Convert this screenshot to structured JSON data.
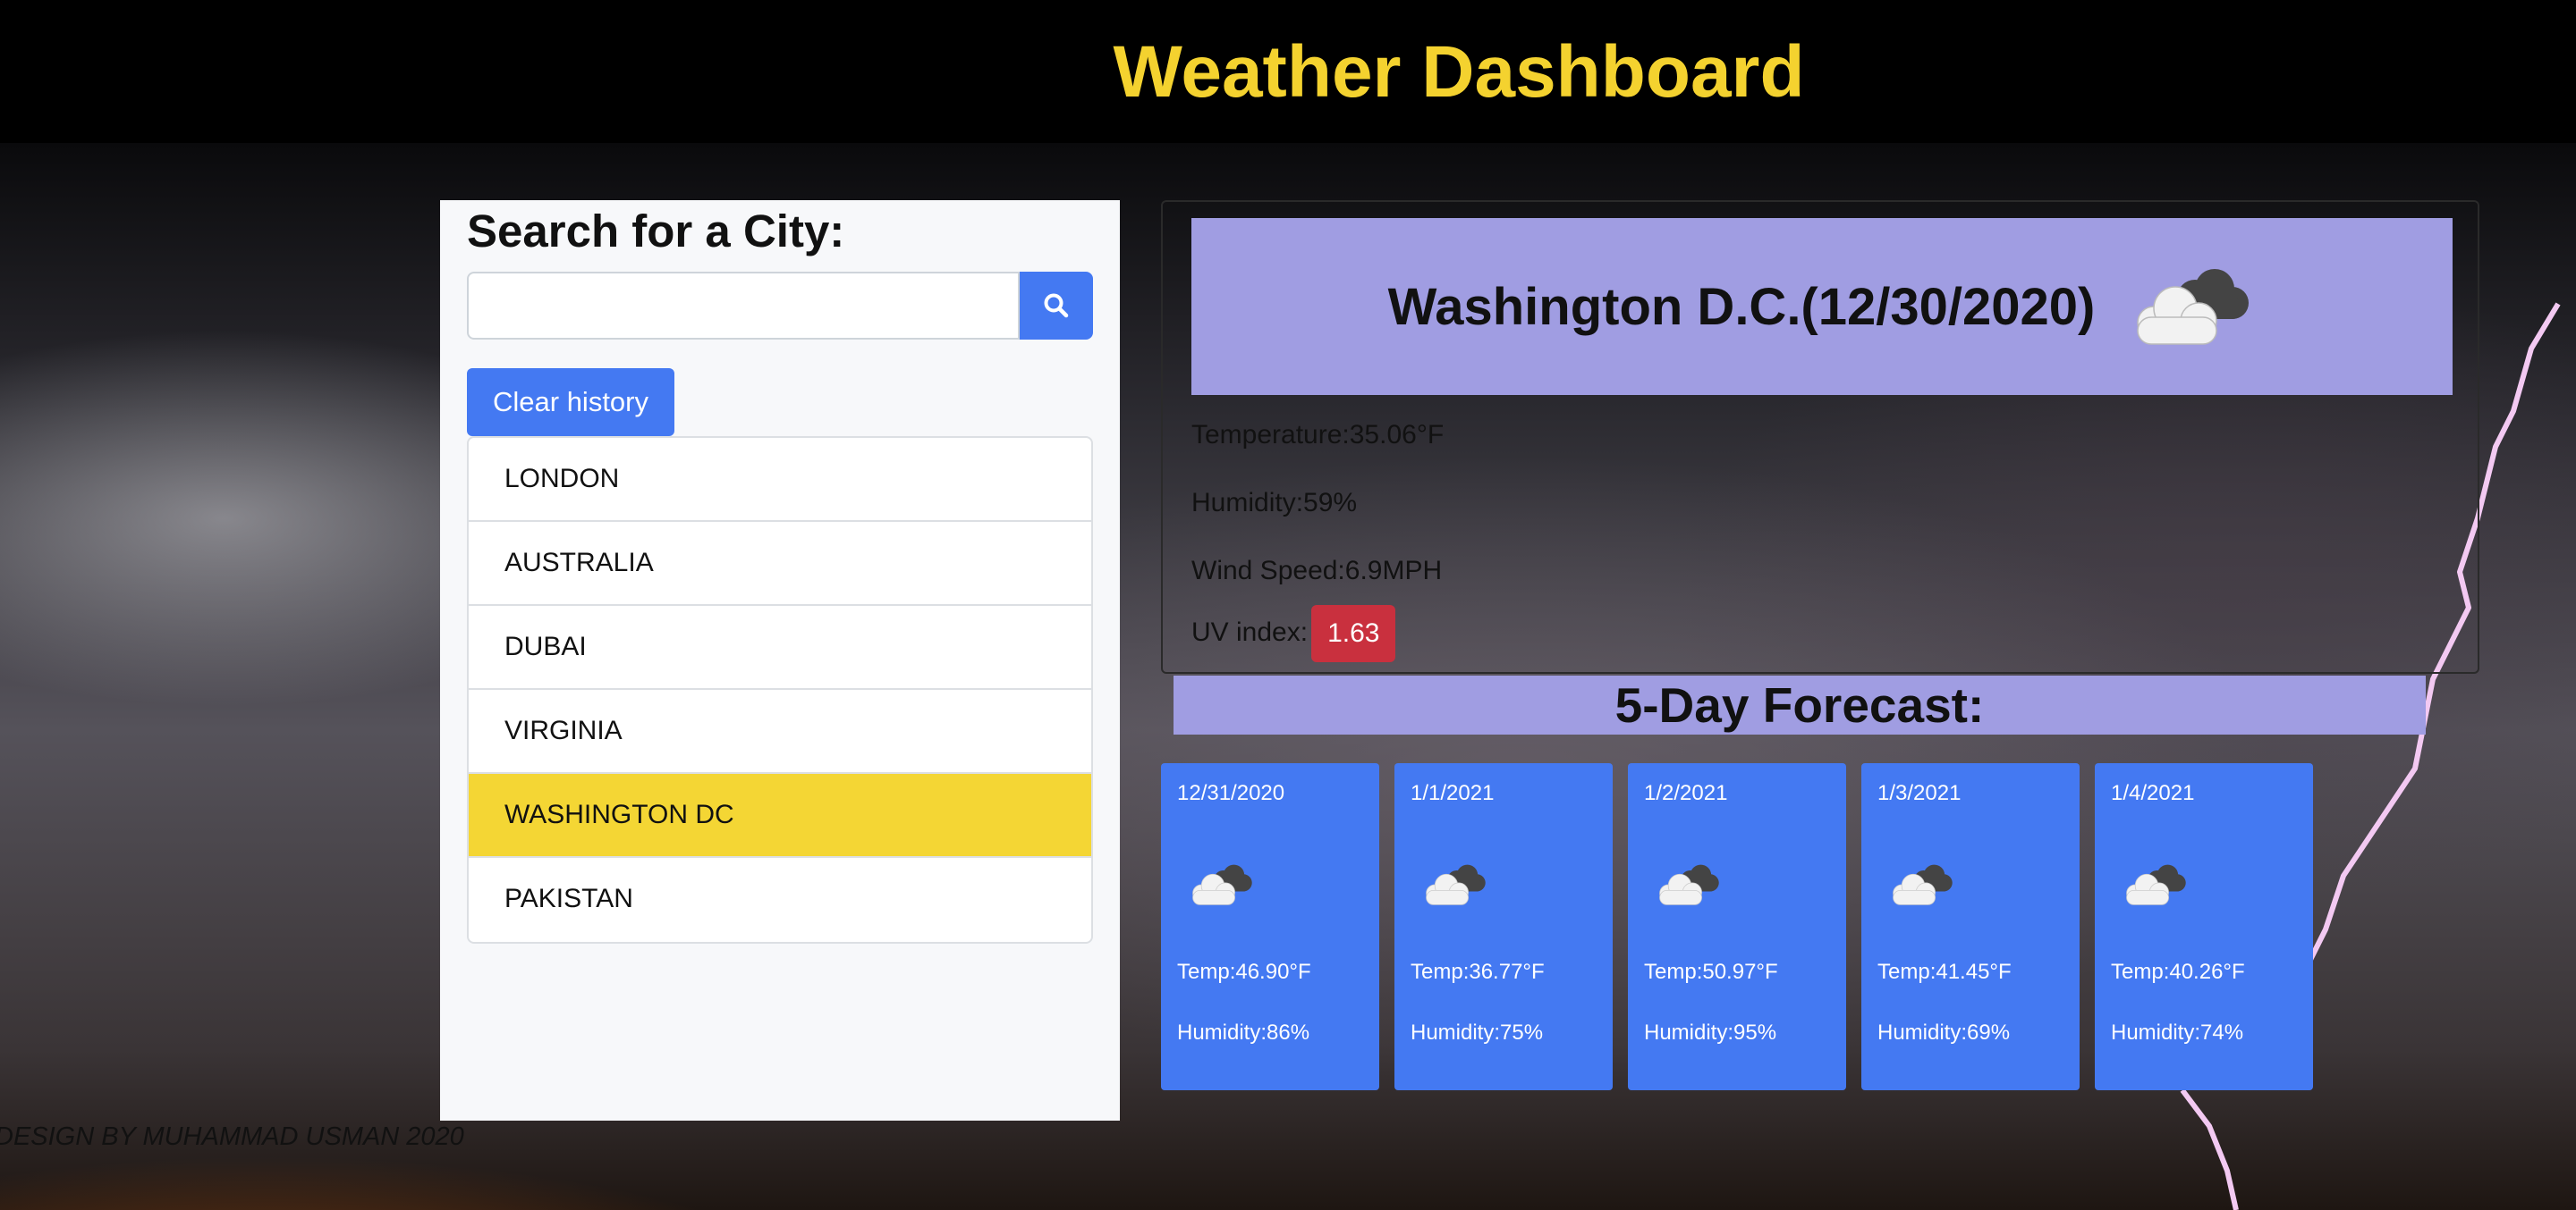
{
  "page": {
    "title": "Weather Dashboard",
    "footer": "DESIGN BY MUHAMMAD USMAN 2020"
  },
  "search": {
    "heading": "Search for a City:",
    "value": "",
    "placeholder": "",
    "button_icon": "search-icon",
    "clear_label": "Clear history"
  },
  "history": [
    {
      "label": "LONDON",
      "active": false
    },
    {
      "label": "AUSTRALIA",
      "active": false
    },
    {
      "label": "DUBAI",
      "active": false
    },
    {
      "label": "VIRGINIA",
      "active": false
    },
    {
      "label": "WASHINGTON DC",
      "active": true
    },
    {
      "label": "PAKISTAN",
      "active": false
    }
  ],
  "current": {
    "city_date": "Washington D.C.(12/30/2020)",
    "icon": "cloudy-icon",
    "temperature": "Temperature:35.06°F",
    "humidity": "Humidity:59%",
    "wind": "Wind Speed:6.9MPH",
    "uv_label": "UV index:",
    "uv_value": "1.63"
  },
  "forecast": {
    "heading": "5-Day Forecast:",
    "days": [
      {
        "date": "12/31/2020",
        "icon": "cloudy-icon",
        "temp": "Temp:46.90°F",
        "humidity": "Humidity:86%"
      },
      {
        "date": "1/1/2021",
        "icon": "cloudy-icon",
        "temp": "Temp:36.77°F",
        "humidity": "Humidity:75%"
      },
      {
        "date": "1/2/2021",
        "icon": "cloudy-icon",
        "temp": "Temp:50.97°F",
        "humidity": "Humidity:95%"
      },
      {
        "date": "1/3/2021",
        "icon": "cloudy-icon",
        "temp": "Temp:41.45°F",
        "humidity": "Humidity:69%"
      },
      {
        "date": "1/4/2021",
        "icon": "cloudy-icon",
        "temp": "Temp:40.26°F",
        "humidity": "Humidity:74%"
      }
    ]
  },
  "colors": {
    "title": "#f4d22f",
    "primary": "#4479f2",
    "header_band": "#a09de2",
    "active_item": "#f4d634",
    "uv_badge": "#c9303e"
  }
}
